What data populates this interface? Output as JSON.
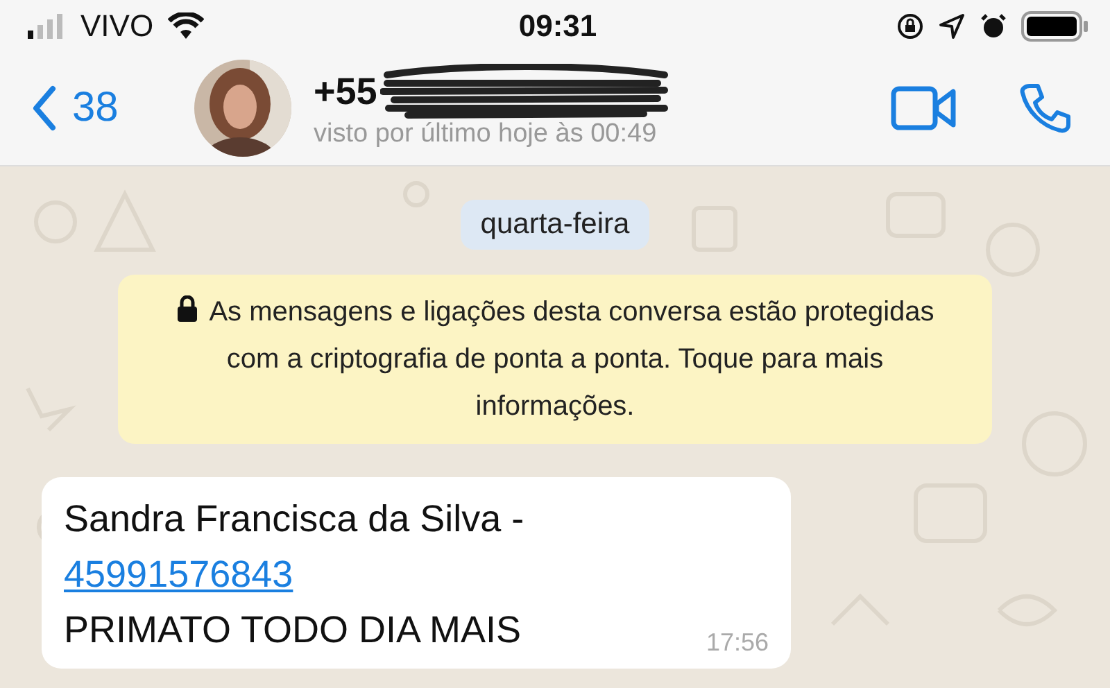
{
  "status_bar": {
    "carrier": "VIVO",
    "time": "09:31"
  },
  "header": {
    "back_count": "38",
    "title": "+55",
    "subtitle": "visto por último hoje às 00:49"
  },
  "date_chip": "quarta-feira",
  "encryption_notice": "As mensagens e ligações desta conversa estão protegidas com a criptografia de ponta a ponta. Toque para mais informações.",
  "message": {
    "lines": [
      {
        "kind": "text",
        "text": "Sandra Francisca da Silva -"
      },
      {
        "kind": "link",
        "text": "45991576843"
      },
      {
        "kind": "text",
        "text": "PRIMATO TODO DIA MAIS"
      }
    ],
    "time": "17:56"
  }
}
